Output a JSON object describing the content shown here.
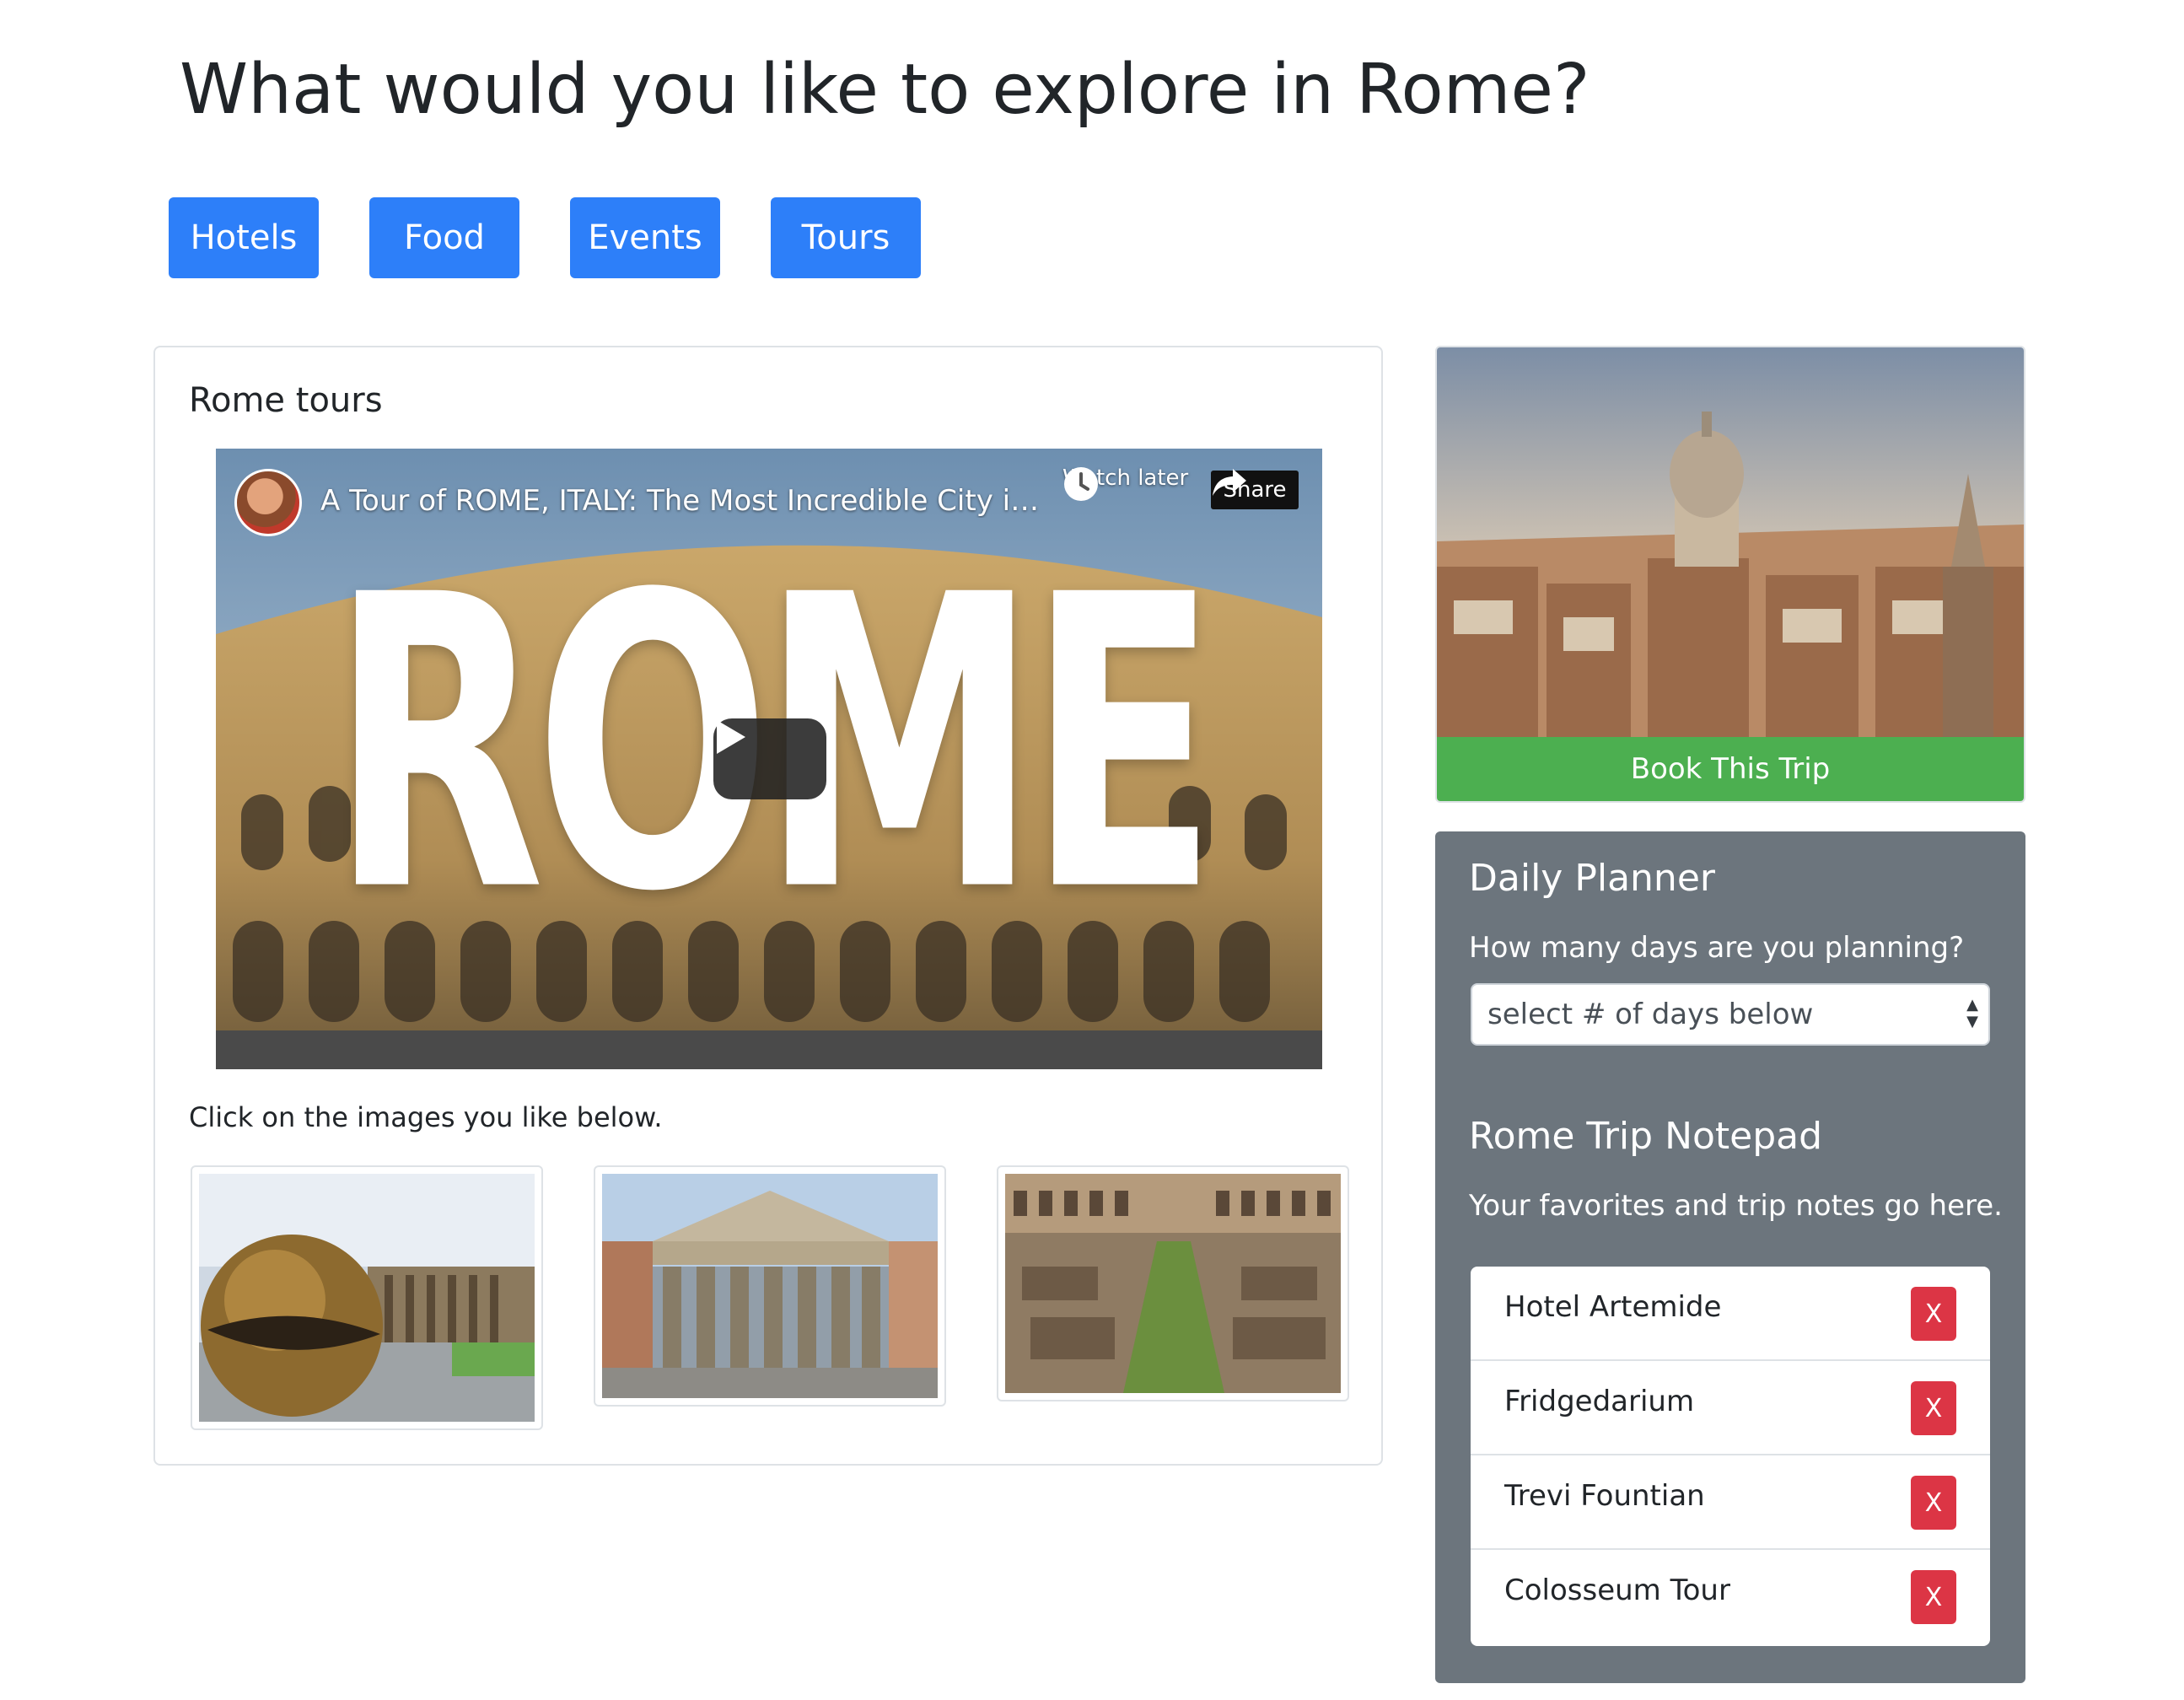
{
  "page": {
    "title": "What would you like to explore in Rome?"
  },
  "categories": [
    {
      "label": "Hotels"
    },
    {
      "label": "Food"
    },
    {
      "label": "Events"
    },
    {
      "label": "Tours"
    }
  ],
  "tours_card": {
    "title": "Rome tours",
    "video": {
      "title": "A Tour of ROME, ITALY: The Most Incredible City in E...",
      "watch_later": "Watch later",
      "share": "Share",
      "overlay_word": "ROME"
    },
    "instruction": "Click on the images you like below."
  },
  "hero": {
    "book_label": "Book This Trip"
  },
  "planner": {
    "title": "Daily Planner",
    "question": "How many days are you planning?",
    "select_value": "select # of days below",
    "notepad_title": "Rome Trip Notepad",
    "notepad_subtitle": "Your favorites and trip notes go here.",
    "items": [
      {
        "text": "Hotel Artemide",
        "delete_label": "X"
      },
      {
        "text": "Fridgedarium",
        "delete_label": "X"
      },
      {
        "text": "Trevi Fountian",
        "delete_label": "X"
      },
      {
        "text": "Colosseum Tour",
        "delete_label": "X"
      }
    ]
  },
  "colors": {
    "primary": "#2d7ff9",
    "success": "#4caf50",
    "danger": "#dc3545",
    "planner_bg": "#6c757d"
  }
}
